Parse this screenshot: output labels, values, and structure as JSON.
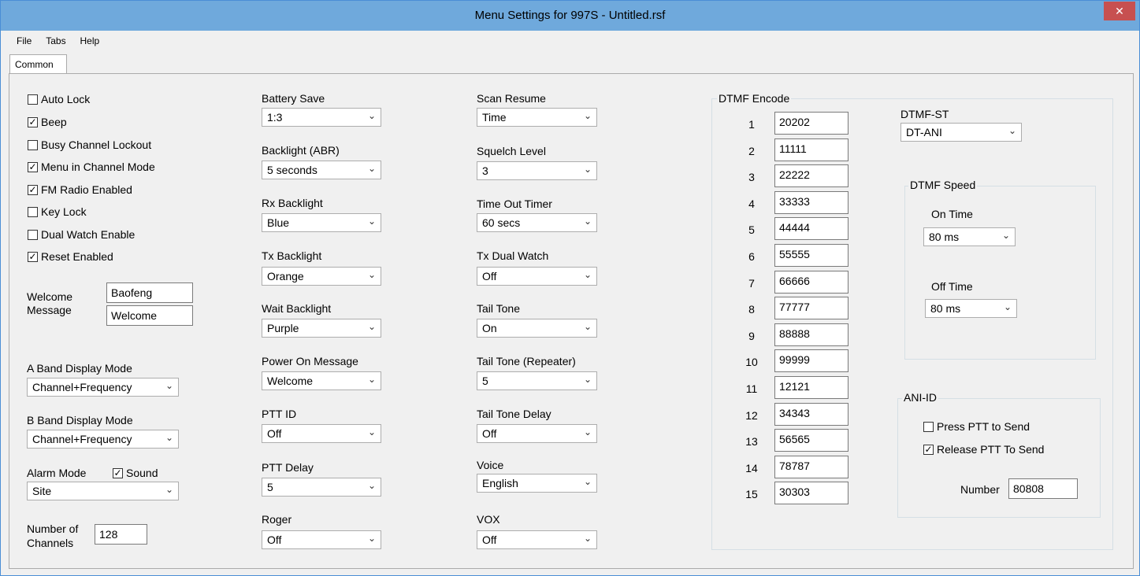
{
  "window": {
    "title": "Menu Settings for 997S - Untitled.rsf",
    "close_label": "✕"
  },
  "menu": {
    "file": "File",
    "tabs": "Tabs",
    "help": "Help"
  },
  "tab": {
    "common": "Common"
  },
  "checks": {
    "auto_lock": {
      "label": "Auto Lock",
      "mark": ""
    },
    "beep": {
      "label": "Beep",
      "mark": "✓"
    },
    "busy_channel_lockout": {
      "label": "Busy Channel Lockout",
      "mark": ""
    },
    "menu_in_channel_mode": {
      "label": "Menu in Channel Mode",
      "mark": "✓"
    },
    "fm_radio_enabled": {
      "label": "FM Radio Enabled",
      "mark": "✓"
    },
    "key_lock": {
      "label": "Key Lock",
      "mark": ""
    },
    "dual_watch_enable": {
      "label": "Dual Watch Enable",
      "mark": ""
    },
    "reset_enabled": {
      "label": "Reset Enabled",
      "mark": "✓"
    }
  },
  "welcome": {
    "label_line1": "Welcome",
    "label_line2": "Message",
    "line1": "Baofeng",
    "line2": "Welcome"
  },
  "a_band": {
    "label": "A Band Display Mode",
    "value": "Channel+Frequency"
  },
  "b_band": {
    "label": "B Band Display Mode",
    "value": "Channel+Frequency"
  },
  "alarm": {
    "label": "Alarm Mode",
    "sound_label": "Sound",
    "sound_mark": "✓",
    "value": "Site"
  },
  "channels": {
    "label_line1": "Number of",
    "label_line2": "Channels",
    "value": "128"
  },
  "col2": [
    {
      "label": "Battery Save",
      "value": "1:3"
    },
    {
      "label": "Backlight (ABR)",
      "value": "5 seconds"
    },
    {
      "label": "Rx Backlight",
      "value": "Blue"
    },
    {
      "label": "Tx Backlight",
      "value": "Orange"
    },
    {
      "label": "Wait Backlight",
      "value": "Purple"
    },
    {
      "label": "Power On Message",
      "value": "Welcome"
    },
    {
      "label": "PTT ID",
      "value": "Off"
    },
    {
      "label": "PTT Delay",
      "value": "5"
    },
    {
      "label": "Roger",
      "value": "Off"
    }
  ],
  "col3": [
    {
      "label": "Scan Resume",
      "value": "Time"
    },
    {
      "label": "Squelch Level",
      "value": "3"
    },
    {
      "label": "Time Out Timer",
      "value": "60 secs"
    },
    {
      "label": "Tx Dual Watch",
      "value": "Off"
    },
    {
      "label": "Tail Tone",
      "value": "On"
    },
    {
      "label": "Tail Tone (Repeater)",
      "value": "5"
    },
    {
      "label": "Tail Tone Delay",
      "value": "Off"
    },
    {
      "label": "Voice",
      "value": "English"
    },
    {
      "label": "VOX",
      "value": "Off"
    }
  ],
  "dtmf": {
    "group_label": "DTMF Encode",
    "rows": [
      {
        "n": "1",
        "code": "20202"
      },
      {
        "n": "2",
        "code": "11111"
      },
      {
        "n": "3",
        "code": "22222"
      },
      {
        "n": "4",
        "code": "33333"
      },
      {
        "n": "5",
        "code": "44444"
      },
      {
        "n": "6",
        "code": "55555"
      },
      {
        "n": "7",
        "code": "66666"
      },
      {
        "n": "8",
        "code": "77777"
      },
      {
        "n": "9",
        "code": "88888"
      },
      {
        "n": "10",
        "code": "99999"
      },
      {
        "n": "11",
        "code": "12121"
      },
      {
        "n": "12",
        "code": "34343"
      },
      {
        "n": "13",
        "code": "56565"
      },
      {
        "n": "14",
        "code": "78787"
      },
      {
        "n": "15",
        "code": "30303"
      }
    ],
    "st_label": "DTMF-ST",
    "st_value": "DT-ANI",
    "speed_label": "DTMF Speed",
    "on_time_label": "On Time",
    "on_time_value": "80 ms",
    "off_time_label": "Off Time",
    "off_time_value": "80 ms"
  },
  "ani": {
    "group_label": "ANI-ID",
    "press_label": "Press PTT to Send",
    "press_mark": "",
    "release_label": "Release PTT To Send",
    "release_mark": "✓",
    "number_label": "Number",
    "number_value": "80808"
  },
  "icons": {
    "dropdown": "⌄"
  }
}
